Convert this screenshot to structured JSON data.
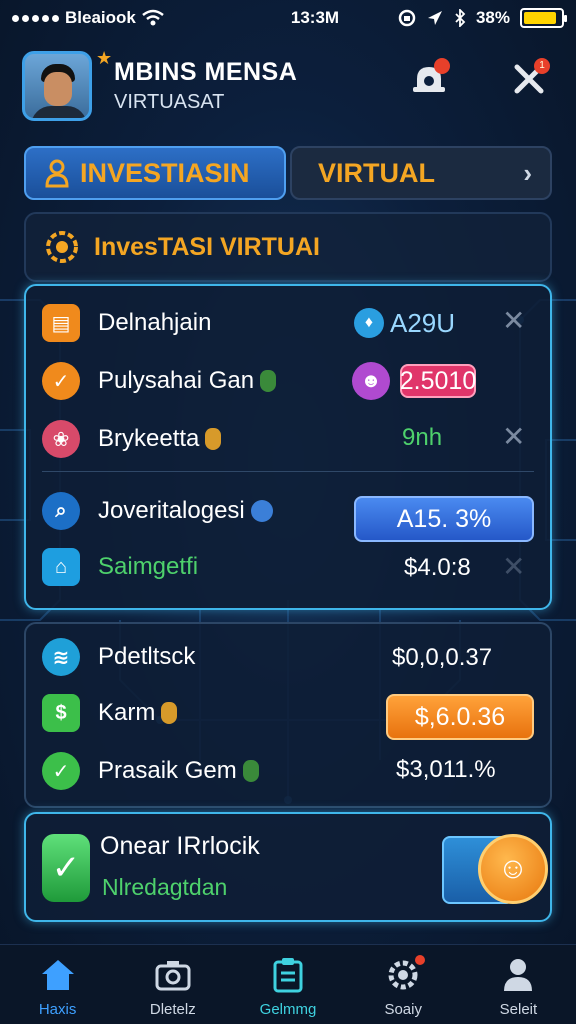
{
  "status_bar": {
    "carrier": "Bleaiook",
    "time": "13:3M",
    "battery": "38%",
    "battery_level": 0.9
  },
  "header": {
    "user_name": "MBINS MENSA",
    "user_subtitle": "VIRTUASAT",
    "avatar_badge_icon": "star-icon",
    "notification_icon": "bell-icon",
    "close_icon": "close-icon"
  },
  "tabs": [
    {
      "label": "INVESTIASIN",
      "icon": "user-icon",
      "active": true
    },
    {
      "label": "VIRTUAL",
      "icon": "chevron-right-icon",
      "active": false
    }
  ],
  "section": {
    "title": "InvesTASI VIRTUAI",
    "icon": "gear-coin-icon"
  },
  "panel1": {
    "rows": [
      {
        "label": "Delnahjain",
        "value": "A29U",
        "icon": "wallet-icon",
        "remove_icon": "close-icon"
      },
      {
        "label": "Pulysahai Gan",
        "value": "2.5010",
        "icon": "check-icon"
      },
      {
        "label": "Brykeetta",
        "value": "9nh",
        "icon": "lotus-icon",
        "remove_icon": "close-icon"
      },
      {
        "label": "Joveritalogesi",
        "value": "A15. 3%",
        "icon": "magnifier-icon"
      },
      {
        "label": "Saimgetfi",
        "value": "$4.0:8",
        "icon": "home-icon",
        "remove_icon": "close-icon"
      }
    ]
  },
  "panel2": {
    "rows": [
      {
        "label": "Pdetltsck",
        "value": "$0,0,0.37",
        "icon": "wifi-icon"
      },
      {
        "label": "Karm",
        "value": "$,6.0.36",
        "icon": "dollar-icon"
      },
      {
        "label": "Prasaik Gem",
        "value": "$3,011.%",
        "icon": "check-icon"
      }
    ]
  },
  "promo": {
    "title": "Onear IRrlocik",
    "subtitle": "Nlredagtdan",
    "icon": "check-icon",
    "coin_icon": "cat-coin-icon"
  },
  "bottom_nav": [
    {
      "label": "Haxis",
      "icon": "home-icon"
    },
    {
      "label": "Dletelz",
      "icon": "camera-icon"
    },
    {
      "label": "Gelmmg",
      "icon": "clipboard-icon"
    },
    {
      "label": "Soaiy",
      "icon": "gear-icon"
    },
    {
      "label": "Seleit",
      "icon": "person-icon"
    }
  ],
  "colors": {
    "accent_orange": "#f4a623",
    "accent_blue": "#3fb6ea",
    "positive_green": "#4ed16c",
    "background": "#0c1f3c"
  }
}
